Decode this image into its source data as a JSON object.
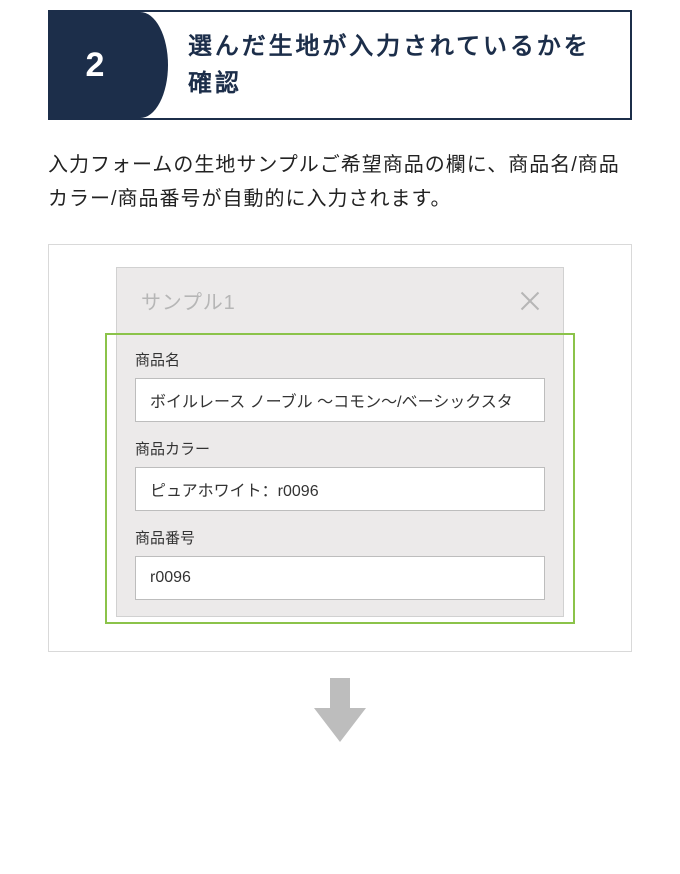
{
  "step": {
    "number": "2",
    "title": "選んだ生地が入力されているかを確認"
  },
  "description": "入力フォームの生地サンプルご希望商品の欄に、商品名/商品カラー/商品番号が自動的に入力されます。",
  "form_card": {
    "title": "サンプル1",
    "fields": {
      "product_name": {
        "label": "商品名",
        "value": "ボイルレース ノーブル 〜コモン〜/ベーシックスタ"
      },
      "product_color": {
        "label": "商品カラー",
        "value": "ピュアホワイト：r0096"
      },
      "product_number": {
        "label": "商品番号",
        "value": "r0096"
      }
    }
  }
}
